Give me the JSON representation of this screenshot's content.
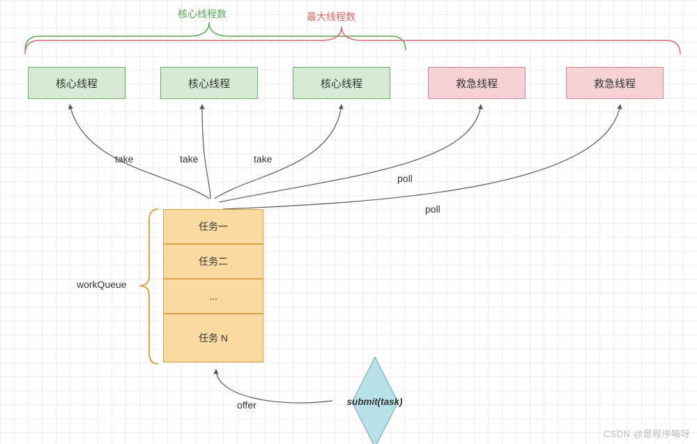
{
  "title_green": "核心线程数",
  "title_red": "最大线程数",
  "threads": {
    "core": [
      "核心线程",
      "核心线程",
      "核心线程"
    ],
    "spare": [
      "救急线程",
      "救急线程"
    ]
  },
  "queue_label": "workQueue",
  "tasks": [
    "任务一",
    "任务二",
    "...",
    "任务 N"
  ],
  "take": "take",
  "poll": "poll",
  "offer": "offer",
  "submit": "submit(task)",
  "watermark": "CSDN @是程序喵呀"
}
